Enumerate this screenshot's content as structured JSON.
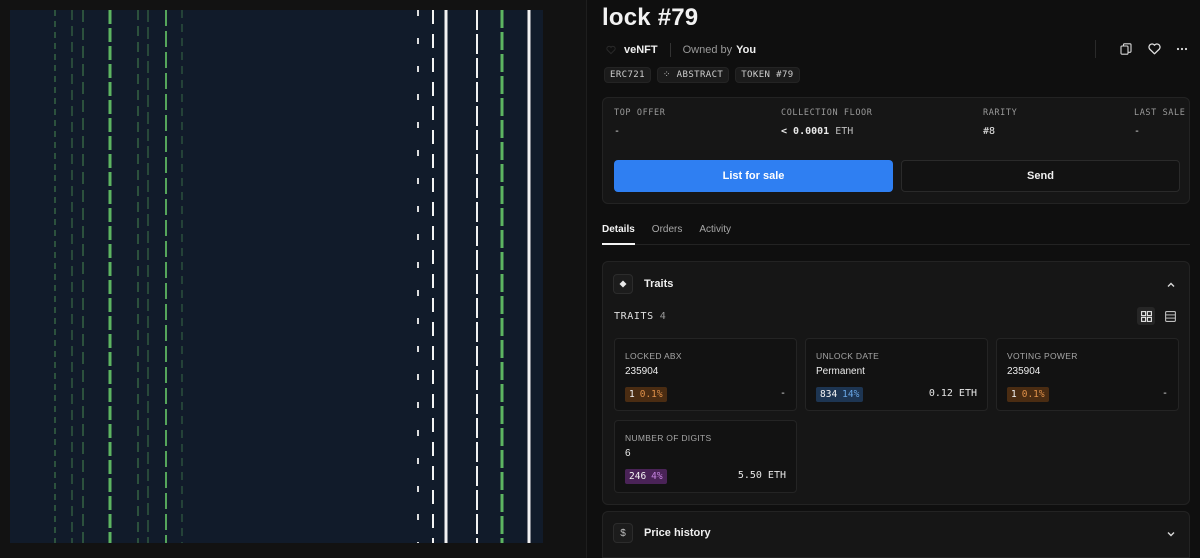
{
  "nft": {
    "title": "lock #79",
    "collection": "veNFT",
    "owned_label": "Owned by",
    "owned_by": "You"
  },
  "badges": [
    "ERC721",
    "⁘ ABSTRACT",
    "TOKEN #79"
  ],
  "actions": {
    "icons": [
      "copy-icon",
      "heart-icon",
      "more-icon"
    ]
  },
  "stats": {
    "top_offer": {
      "label": "TOP OFFER",
      "value": "-"
    },
    "collection_floor": {
      "label": "COLLECTION FLOOR",
      "prefix": "< ",
      "value": "0.0001",
      "unit": " ETH"
    },
    "rarity": {
      "label": "RARITY",
      "value": "#8"
    },
    "last_sale": {
      "label": "LAST SALE",
      "value": "-"
    }
  },
  "buttons": {
    "list_for_sale": "List for sale",
    "send": "Send"
  },
  "tabs": [
    {
      "label": "Details",
      "active": true
    },
    {
      "label": "Orders",
      "active": false
    },
    {
      "label": "Activity",
      "active": false
    }
  ],
  "traits_section": {
    "title": "Traits",
    "count_label": "TRAITS",
    "count": "4",
    "items": [
      {
        "label": "LOCKED ABX",
        "value": "235904",
        "count": "1",
        "percent": "0.1%",
        "color": "orange",
        "price": "-"
      },
      {
        "label": "UNLOCK DATE",
        "value": "Permanent",
        "count": "834",
        "percent": "14%",
        "color": "blue",
        "price": "0.12 ETH"
      },
      {
        "label": "VOTING POWER",
        "value": "235904",
        "count": "1",
        "percent": "0.1%",
        "color": "orange",
        "price": "-"
      },
      {
        "label": "NUMBER OF DIGITS",
        "value": "6",
        "count": "246",
        "percent": "4%",
        "color": "purple",
        "price": "5.50 ETH"
      }
    ]
  },
  "price_history": {
    "title": "Price history",
    "icon_text": "$"
  },
  "colors": {
    "accent": "#2f7ff2",
    "art_background": "#111b2a",
    "art_green": "#5db561",
    "art_white": "#f2f2f2"
  }
}
